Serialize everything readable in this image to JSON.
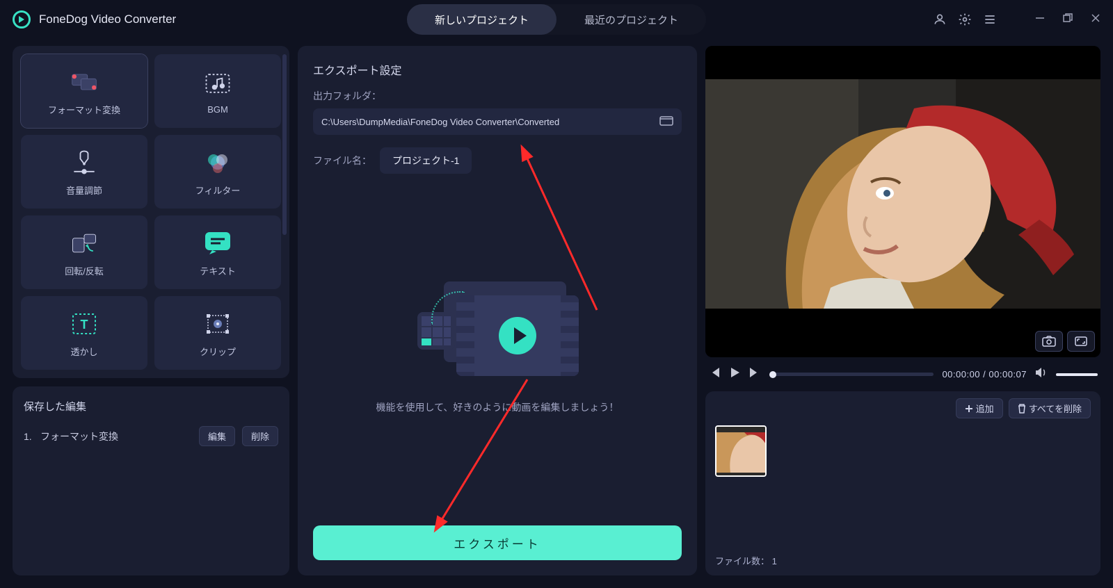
{
  "app": {
    "title": "FoneDog Video Converter"
  },
  "tabs": {
    "new": "新しいプロジェクト",
    "recent": "最近のプロジェクト"
  },
  "tools": [
    {
      "id": "format",
      "label": "フォーマット変換"
    },
    {
      "id": "bgm",
      "label": "BGM"
    },
    {
      "id": "volume",
      "label": "音量調節"
    },
    {
      "id": "filter",
      "label": "フィルター"
    },
    {
      "id": "rotate",
      "label": "回転/反転"
    },
    {
      "id": "text",
      "label": "テキスト"
    },
    {
      "id": "watermark",
      "label": "透かし"
    },
    {
      "id": "clip",
      "label": "クリップ"
    }
  ],
  "saved": {
    "title": "保存した編集",
    "items": [
      {
        "index": "1.",
        "name": "フォーマット変換"
      }
    ],
    "edit": "編集",
    "delete": "削除"
  },
  "export": {
    "title": "エクスポート設定",
    "folder_label": "出力フォルダ：",
    "folder_path": "C:\\Users\\DumpMedia\\FoneDog Video Converter\\Converted",
    "filename_label": "ファイル名：",
    "filename": "プロジェクト-1",
    "hint": "機能を使用して、好きのように動画を編集しましょう！",
    "button": "エクスポート"
  },
  "player": {
    "current": "00:00:00",
    "total": "00:00:07",
    "separator": " / "
  },
  "thumbs": {
    "add": "追加",
    "delete_all": "すべてを削除",
    "count_label": "ファイル数：",
    "count": "1"
  }
}
